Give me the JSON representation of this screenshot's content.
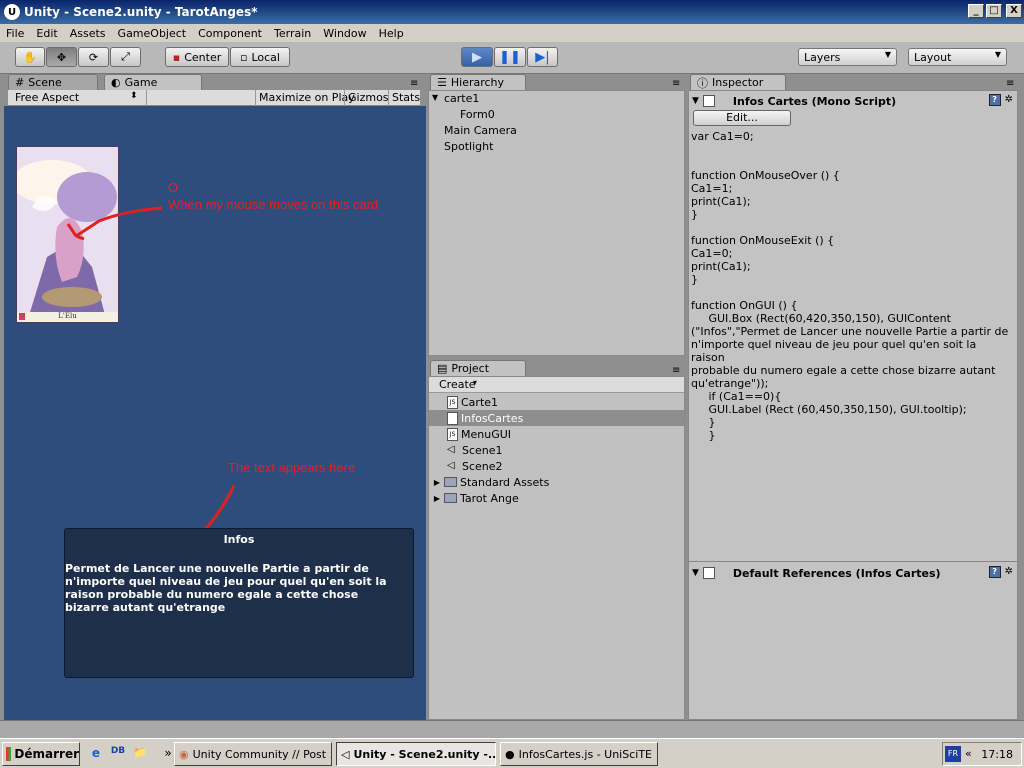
{
  "window": {
    "title": "Unity - Scene2.unity - TarotAnges*",
    "logo_letter": "U",
    "controls": {
      "minimize": "_",
      "maximize": "□",
      "close": "X"
    }
  },
  "menubar": [
    "File",
    "Edit",
    "Assets",
    "GameObject",
    "Component",
    "Terrain",
    "Window",
    "Help"
  ],
  "toolbar": {
    "tools": [
      {
        "name": "hand-tool-button",
        "icon": "✋"
      },
      {
        "name": "move-tool-button",
        "icon": "✥"
      },
      {
        "name": "rotate-tool-button",
        "icon": "⟳"
      },
      {
        "name": "scale-tool-button",
        "icon": "⤢"
      }
    ],
    "pivot": "Center",
    "pivot_icon": "▪",
    "space": "Local",
    "space_icon": "▫",
    "play_icon": "▶",
    "pause_icon": "❚❚",
    "step_icon": "▶|",
    "layers": "Layers",
    "layout": "Layout",
    "dropdown_arrow": "▼"
  },
  "tabs": {
    "scene": "Scene",
    "scene_icon": "#",
    "game": "Game",
    "game_icon": "◐",
    "hierarchy": "Hierarchy",
    "hierarchy_icon": "☰",
    "project": "Project",
    "project_icon": "▤",
    "inspector": "Inspector",
    "inspector_icon": "ⓘ",
    "panel_menu": "≡"
  },
  "game_toolbar": {
    "aspect": "Free Aspect",
    "aspect_arrow": "⬍",
    "maximize": "Maximize on Play",
    "gizmos": "Gizmos",
    "stats": "Stats"
  },
  "game_view": {
    "card_label": "L'Élu",
    "annotation_card": "When my mouse moves on this card",
    "annotation_card_circle": "O",
    "annotation_text": "The text appears here",
    "infobox_title": "Infos",
    "infobox_text": "Permet de Lancer une nouvelle Partie a partir de n'importe quel niveau de jeu pour quel qu'en soit la raison probable du numero egale a cette chose bizarre autant qu'etrange"
  },
  "hierarchy": {
    "items": [
      {
        "label": "carte1",
        "expanded": true
      },
      {
        "label": "Form0"
      },
      {
        "label": "Main Camera"
      },
      {
        "label": "Spotlight"
      }
    ],
    "expand_icon": "▼"
  },
  "project": {
    "create": "Create",
    "create_arrow": "▾",
    "items": [
      {
        "label": "Carte1",
        "type": "js"
      },
      {
        "label": "InfosCartes",
        "type": "js",
        "selected": true
      },
      {
        "label": "MenuGUI",
        "type": "js"
      },
      {
        "label": "Scene1",
        "type": "scene"
      },
      {
        "label": "Scene2",
        "type": "scene"
      },
      {
        "label": "Standard Assets",
        "type": "folder"
      },
      {
        "label": "Tarot Ange",
        "type": "folder"
      }
    ],
    "js_badge": "JS",
    "scene_icon": "◁",
    "folder_arrow": "▶"
  },
  "inspector": {
    "component_title": "Infos Cartes (Mono Script)",
    "collapse_icon": "▼",
    "help_icon": "?",
    "gear_icon": "✲",
    "edit_button": "Edit...",
    "code": "var Ca1=0;\n\n\nfunction OnMouseOver () {\nCa1=1;\nprint(Ca1);\n}\n\nfunction OnMouseExit () {\nCa1=0;\nprint(Ca1);\n}\n\nfunction OnGUI () {\n     GUI.Box (Rect(60,420,350,150), GUIContent\n(\"Infos\",\"Permet de Lancer une nouvelle Partie a partir de\nn'importe quel niveau de jeu pour quel qu'en soit la raison\nprobable du numero egale a cette chose bizarre autant\nqu'etrange\"));\n     if (Ca1==0){\n     GUI.Label (Rect (60,450,350,150), GUI.tooltip);\n     }\n     }",
    "default_refs_title": "Default References (Infos Cartes)"
  },
  "taskbar": {
    "start": "Démarrer",
    "quicklaunch": {
      "chevron": "»",
      "ie": "e",
      "db": "DB",
      "folder": "📁"
    },
    "tasks": [
      {
        "label": "Unity Community // Post ...",
        "icon": "◉"
      },
      {
        "label": "Unity - Scene2.unity -...",
        "icon": "◁",
        "active": true
      },
      {
        "label": "InfosCartes.js - UniSciTE",
        "icon": "●"
      }
    ],
    "lang": "FR",
    "arrows": "«",
    "time": "17:18"
  }
}
